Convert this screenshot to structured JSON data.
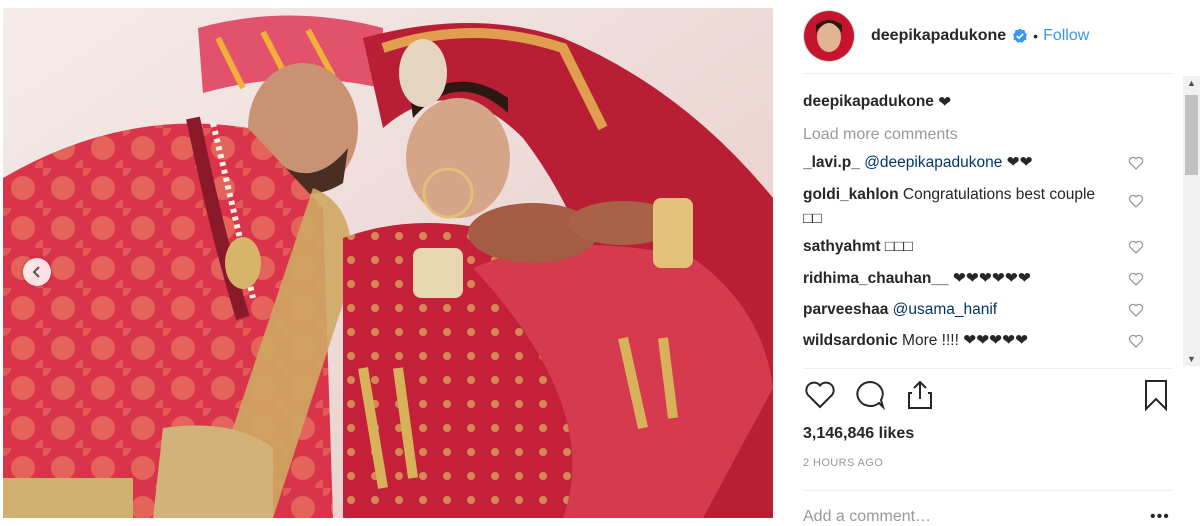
{
  "post": {
    "photo_alt": "Wedding photo",
    "carousel": {
      "prev_icon": "chevron-left-icon"
    }
  },
  "header": {
    "username": "deepikapadukone",
    "verified_icon": "verified-badge-icon",
    "dot": "•",
    "follow_label": "Follow",
    "accent_color": "#3897f0"
  },
  "caption": {
    "username": "deepikapadukone",
    "text": "❤"
  },
  "load_more": "Load more comments",
  "comments": [
    {
      "user": "_lavi.p_",
      "mention": "@deepikapadukone",
      "text": " ❤❤"
    },
    {
      "user": "goldi_kahlon",
      "mention": "",
      "text": " Congratulations best couple □□"
    },
    {
      "user": "sathyahmt",
      "mention": "",
      "text": " □□□"
    },
    {
      "user": "ridhima_chauhan__",
      "mention": "",
      "text": " ❤❤❤❤❤❤"
    },
    {
      "user": "parveeshaa",
      "mention": "@usama_hanif",
      "text": ""
    },
    {
      "user": "wildsardonic",
      "mention": "",
      "text": " More !!!! ❤❤❤❤❤"
    }
  ],
  "actions": {
    "like_icon": "heart-icon",
    "comment_icon": "comment-bubble-icon",
    "share_icon": "share-icon",
    "save_icon": "bookmark-icon"
  },
  "likes": "3,146,846 likes",
  "timestamp": "2 HOURS AGO",
  "add_comment_placeholder": "Add a comment…",
  "more_label": "•••"
}
